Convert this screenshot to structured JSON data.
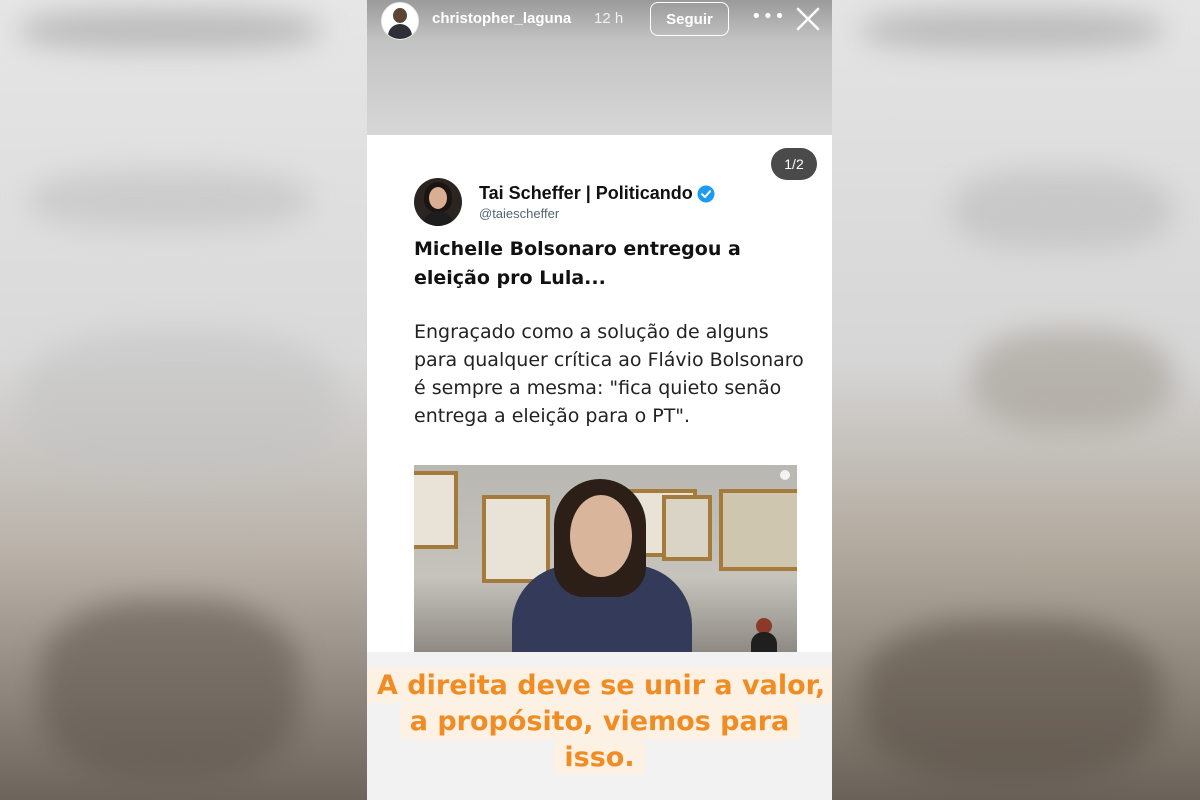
{
  "story": {
    "username": "christopher_laguna",
    "time": "12 h",
    "follow_label": "Seguir",
    "more_label": "•••"
  },
  "tweet": {
    "page_indicator": "1/2",
    "author_name": "Tai Scheffer | Politicando",
    "author_handle": "@taiescheffer",
    "headline": "Michelle Bolsonaro entregou a eleição pro Lula...",
    "body": "Engraçado como a solução de alguns para qualquer crítica ao Flávio Bolsonaro é sempre a mesma: \"fica quieto senão entrega a eleição para o PT\"."
  },
  "caption": {
    "text": "A direita deve se unir a valor, a propósito, viemos para isso."
  },
  "colors": {
    "caption_text": "#f08c24",
    "caption_bg": "#fdf1e4",
    "verified": "#1d9bf0"
  },
  "icons": {
    "close": "close-icon",
    "verified": "verified-badge-icon",
    "more": "more-options-icon"
  }
}
